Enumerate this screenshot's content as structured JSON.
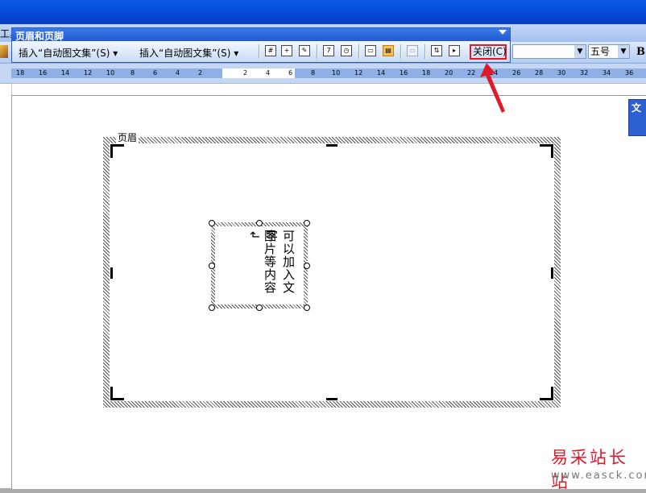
{
  "menubar": {
    "left_label": "工具"
  },
  "hf_toolbar": {
    "title": "页眉和页脚",
    "insert_autotext_1": "插入“自动图文集”(S) ▾",
    "insert_autotext_2": "插入“自动图文集”(S) ▾",
    "close_label": "关闭(C)"
  },
  "format": {
    "font_size": "五号",
    "bold_label": "B"
  },
  "ruler": {
    "ticks": [
      "18",
      "16",
      "14",
      "12",
      "10",
      "8",
      "6",
      "4",
      "2",
      "2",
      "4",
      "6",
      "8",
      "10",
      "12",
      "14",
      "16",
      "18",
      "20",
      "22",
      "24",
      "26",
      "28",
      "30",
      "32",
      "34",
      "36"
    ]
  },
  "document": {
    "header_label": "页眉",
    "textbox_col1": "可以加入文字",
    "textbox_col2": "图片等内容↲"
  },
  "task_pane": {
    "label": "文"
  },
  "watermark": {
    "cn": "易采站长站",
    "url": "www.easck.com"
  },
  "colors": {
    "accent_blue": "#2159d2",
    "annotation_red": "#e0192b"
  }
}
